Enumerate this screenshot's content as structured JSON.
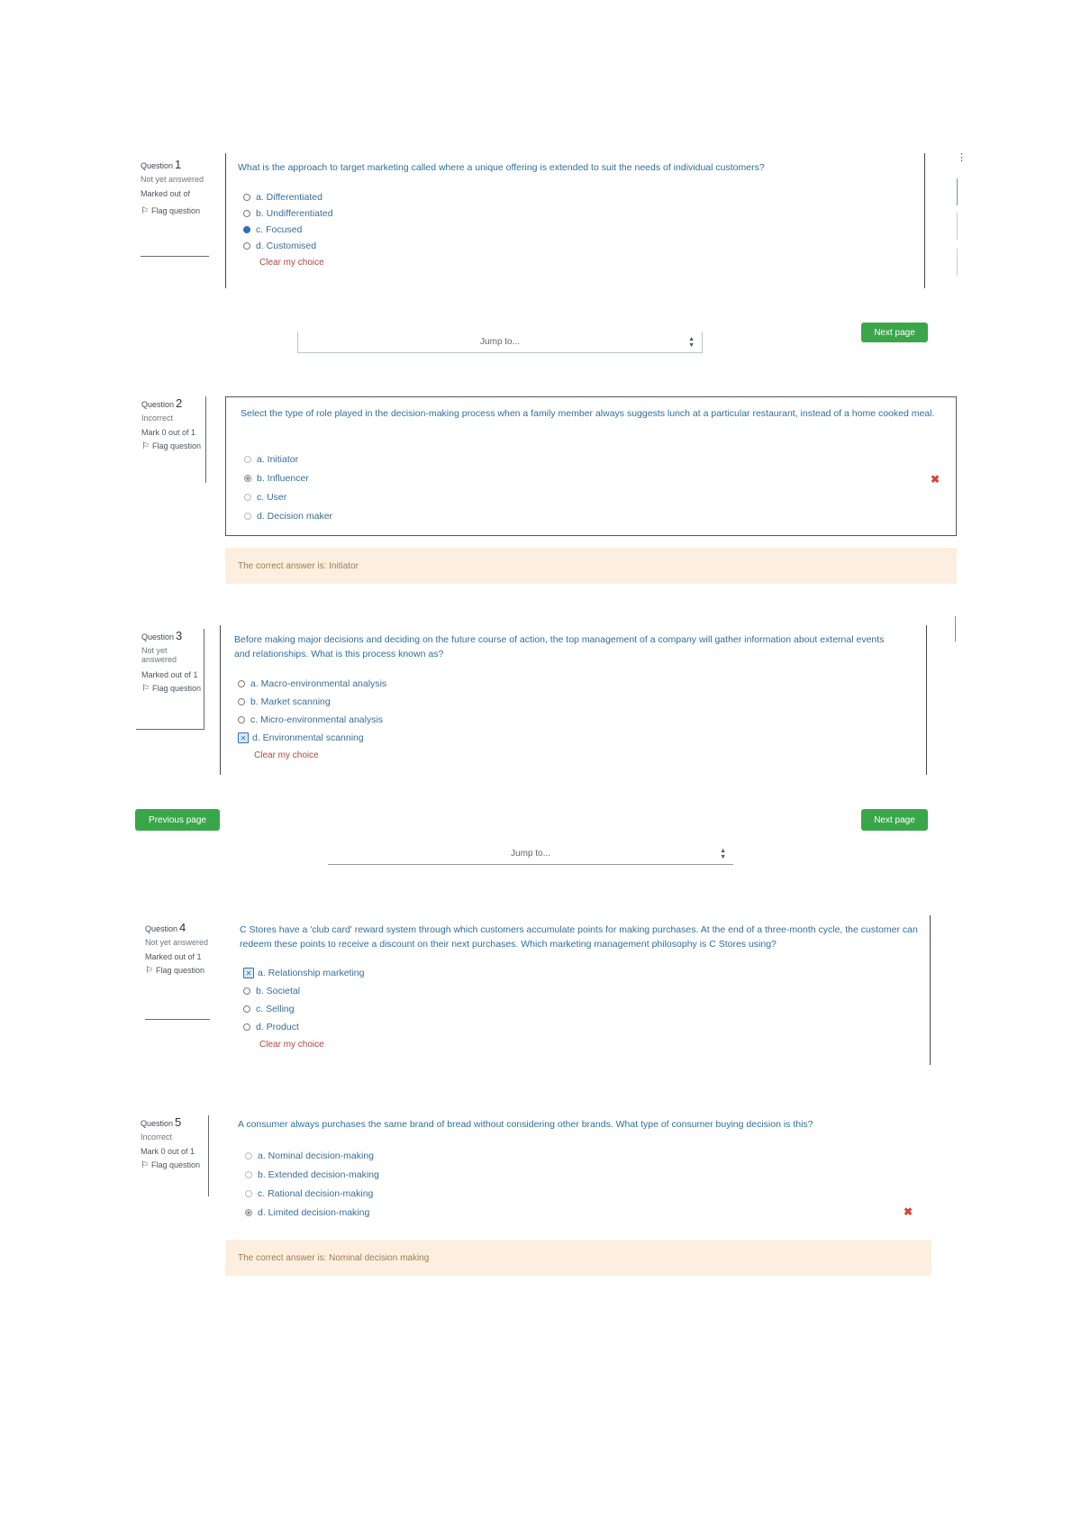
{
  "q1": {
    "label": "Question",
    "num": "1",
    "state": "Not yet answered",
    "mark": "Marked out of",
    "flag": "Flag question",
    "text": "What is the approach to target marketing called where a unique offering is extended to suit the needs of individual customers?",
    "options": [
      "a. Differentiated",
      "b. Undifferentiated",
      "c. Focused",
      "d. Customised"
    ],
    "clear": "Clear my choice"
  },
  "nav1": {
    "jump": "Jump to...",
    "next": "Next page"
  },
  "q2": {
    "label": "Question",
    "num": "2",
    "state": "Incorrect",
    "mark": "Mark 0 out of 1",
    "flag": "Flag question",
    "text": "Select the type of role played in the decision-making process when a family member always suggests lunch at a particular restaurant, instead of a home cooked meal.",
    "options": [
      "a. Initiator",
      "b. Influencer",
      "c. User",
      "d. Decision maker"
    ],
    "feedback": "The correct answer is: Initiator"
  },
  "q3": {
    "label": "Question",
    "num": "3",
    "state": "Not yet answered",
    "mark": "Marked out of 1",
    "flag": "Flag question",
    "text": "Before making major decisions and deciding on the future course of action, the top management of a company will gather information about external events and relationships. What is this process known as?",
    "options": [
      "a. Macro-environmental analysis",
      "b. Market scanning",
      "c. Micro-environmental analysis",
      "d. Environmental scanning"
    ],
    "clear": "Clear my choice"
  },
  "nav2": {
    "prev": "Previous page",
    "next": "Next page",
    "jump": "Jump to..."
  },
  "q4": {
    "label": "Question",
    "num": "4",
    "state": "Not yet answered",
    "mark": "Marked out of 1",
    "flag": "Flag question",
    "text": "C Stores have a 'club card' reward system through which customers accumulate points for making purchases. At the end of a three-month cycle, the customer can redeem these points to receive a discount on their next purchases. Which marketing management philosophy is C Stores using?",
    "options": [
      "a. Relationship marketing",
      "b. Societal",
      "c. Selling",
      "d. Product"
    ],
    "clear": "Clear my choice"
  },
  "q5": {
    "label": "Question",
    "num": "5",
    "state": "Incorrect",
    "mark": "Mark 0 out of 1",
    "flag": "Flag question",
    "text": "A consumer always purchases the same brand of bread without considering other brands. What type of consumer buying decision is this?",
    "options": [
      "a. Nominal decision-making",
      "b. Extended decision-making",
      "c. Rational decision-making",
      "d. Limited decision-making"
    ],
    "feedback": "The correct answer is: Nominal decision making"
  },
  "icons": {
    "flag": "flag-icon",
    "cross": "cross-icon",
    "caret": "select-caret-icon"
  }
}
